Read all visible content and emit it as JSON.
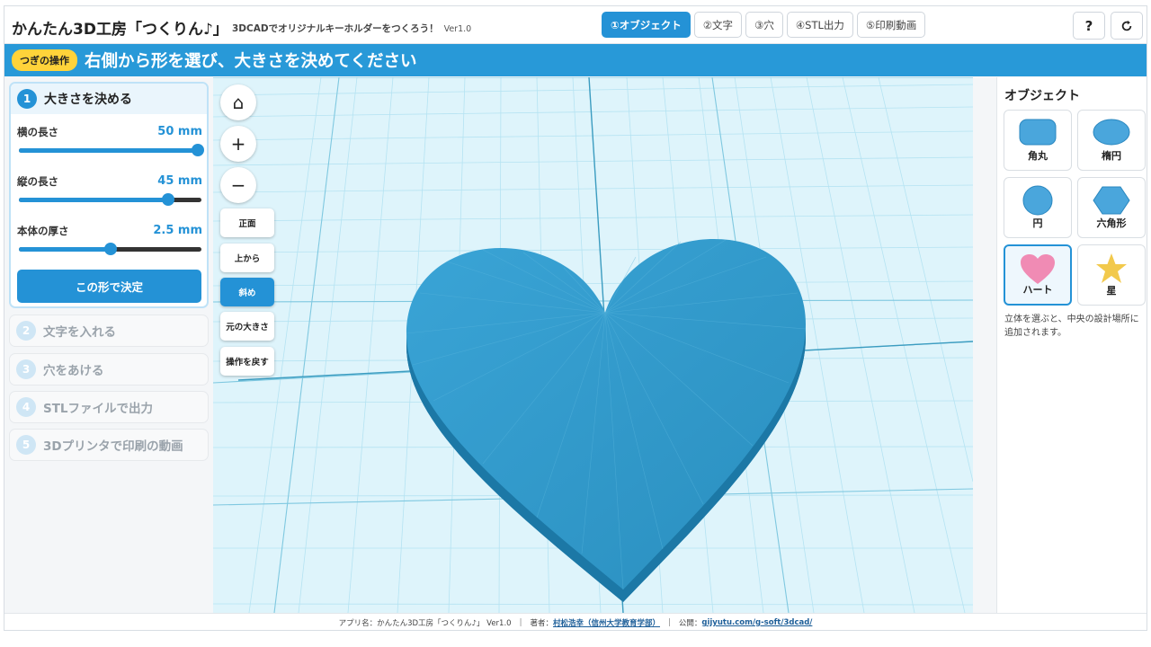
{
  "header": {
    "title": "かんたん3D工房「つくりん♪」",
    "subtitle": "3DCADでオリジナルキーホルダーをつくろう！",
    "version": "Ver1.0",
    "tabs": [
      {
        "label": "①オブジェクト",
        "active": true
      },
      {
        "label": "②文字",
        "active": false
      },
      {
        "label": "③穴",
        "active": false
      },
      {
        "label": "④STL出力",
        "active": false
      },
      {
        "label": "⑤印刷動画",
        "active": false
      }
    ],
    "help_label": "?",
    "reset_icon": "refresh-icon"
  },
  "banner": {
    "badge": "つぎの操作",
    "text": "右側から形を選び、大きさを決めてください"
  },
  "left_panel": {
    "active_step": {
      "number": "1",
      "title": "大きさを決める",
      "params": [
        {
          "label": "横の長さ",
          "value": "50 mm",
          "level": 0.98
        },
        {
          "label": "縦の長さ",
          "value": "45 mm",
          "level": 0.82
        },
        {
          "label": "本体の厚さ",
          "value": "2.5 mm",
          "level": 0.5
        }
      ],
      "decide_label": "この形で決定"
    },
    "steps": [
      {
        "number": "2",
        "title": "文字を入れる"
      },
      {
        "number": "3",
        "title": "穴をあける"
      },
      {
        "number": "4",
        "title": "STLファイルで出力"
      },
      {
        "number": "5",
        "title": "3Dプリンタで印刷の動画"
      }
    ]
  },
  "viewport": {
    "icon_buttons": [
      {
        "icon": "home-icon",
        "glyph": "⌂"
      },
      {
        "icon": "zoom-in-icon",
        "glyph": "+"
      },
      {
        "icon": "zoom-out-icon",
        "glyph": "−"
      }
    ],
    "view_buttons": [
      {
        "label": "正面",
        "active": false
      },
      {
        "label": "上から",
        "active": false
      },
      {
        "label": "斜め",
        "active": true
      },
      {
        "label": "元の大きさ",
        "active": false
      },
      {
        "label": "操作を戻す",
        "active": false
      }
    ],
    "model_color": "#2a93c4",
    "model_top_color": "#2f9bcd",
    "background_color": "#def4fb"
  },
  "right_panel": {
    "title": "オブジェクト",
    "shapes": [
      {
        "label": "角丸",
        "icon": "rounded-square-icon",
        "selected": false
      },
      {
        "label": "楕円",
        "icon": "ellipse-icon",
        "selected": false
      },
      {
        "label": "円",
        "icon": "circle-icon",
        "selected": false
      },
      {
        "label": "六角形",
        "icon": "hexagon-icon",
        "selected": false
      },
      {
        "label": "ハート",
        "icon": "heart-icon",
        "selected": true
      },
      {
        "label": "星",
        "icon": "star-icon",
        "selected": false
      }
    ],
    "note": "立体を選ぶと、中央の設計場所に追加されます。"
  },
  "footer": {
    "app_name": "アプリ名：かんたん3D工房「つくりん♪」 Ver1.0",
    "author_label": "著者：",
    "author_link": "村松浩幸（信州大学教育学部）",
    "publish_label": "公開：",
    "publish_link": "gijyutu.com/g-soft/3dcad/"
  },
  "colors": {
    "accent": "#2492d6",
    "banner": "#2899d8",
    "badge": "#ffd33a",
    "heart_pink": "#f08bb4",
    "star_yellow": "#f2c94c"
  }
}
